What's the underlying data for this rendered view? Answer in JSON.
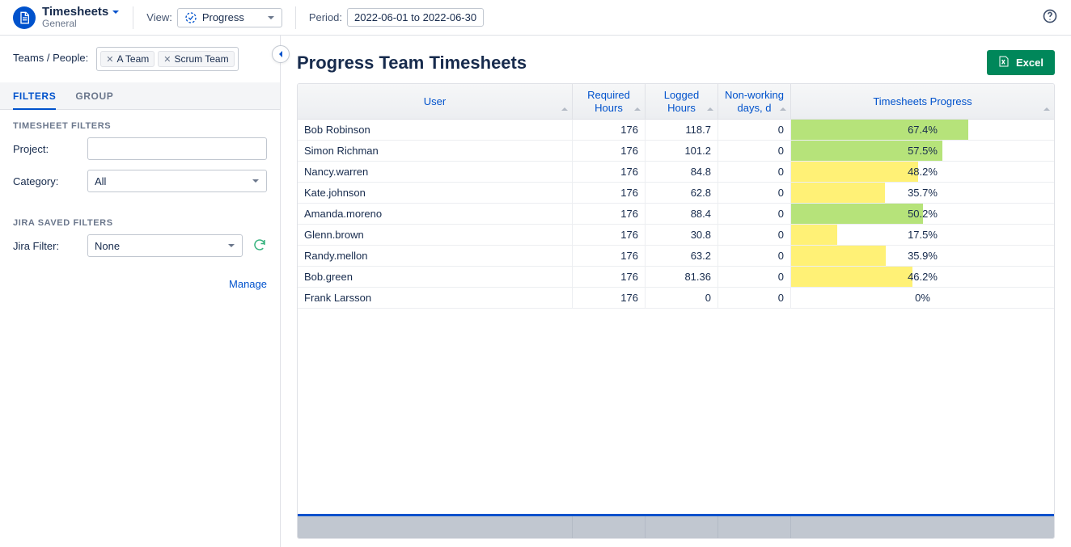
{
  "header": {
    "app_title": "Timesheets",
    "app_subtitle": "General",
    "view_label": "View:",
    "view_value": "Progress",
    "period_label": "Period:",
    "period_value": "2022-06-01 to 2022-06-30"
  },
  "sidebar": {
    "teams_label": "Teams / People:",
    "chips": [
      "A Team",
      "Scrum Team"
    ],
    "tabs": {
      "filters": "FILTERS",
      "group": "GROUP"
    },
    "timesheet_filters_title": "TIMESHEET FILTERS",
    "project_label": "Project:",
    "project_value": "",
    "category_label": "Category:",
    "category_value": "All",
    "jira_filters_title": "JIRA SAVED FILTERS",
    "jira_filter_label": "Jira Filter:",
    "jira_filter_value": "None",
    "manage_label": "Manage"
  },
  "main": {
    "title": "Progress Team Timesheets",
    "excel_label": "Excel",
    "columns": {
      "user": "User",
      "required": "Required Hours",
      "logged": "Logged Hours",
      "nwd": "Non-working days, d",
      "progress": "Timesheets Progress"
    },
    "rows": [
      {
        "user": "Bob Robinson",
        "required": "176",
        "logged": "118.7",
        "nwd": "0",
        "progress_pct": 67.4,
        "progress_label": "67.4%",
        "bar_color": "green"
      },
      {
        "user": "Simon Richman",
        "required": "176",
        "logged": "101.2",
        "nwd": "0",
        "progress_pct": 57.5,
        "progress_label": "57.5%",
        "bar_color": "green"
      },
      {
        "user": "Nancy.warren",
        "required": "176",
        "logged": "84.8",
        "nwd": "0",
        "progress_pct": 48.2,
        "progress_label": "48.2%",
        "bar_color": "yellow"
      },
      {
        "user": "Kate.johnson",
        "required": "176",
        "logged": "62.8",
        "nwd": "0",
        "progress_pct": 35.7,
        "progress_label": "35.7%",
        "bar_color": "yellow"
      },
      {
        "user": "Amanda.moreno",
        "required": "176",
        "logged": "88.4",
        "nwd": "0",
        "progress_pct": 50.2,
        "progress_label": "50.2%",
        "bar_color": "green"
      },
      {
        "user": "Glenn.brown",
        "required": "176",
        "logged": "30.8",
        "nwd": "0",
        "progress_pct": 17.5,
        "progress_label": "17.5%",
        "bar_color": "yellow"
      },
      {
        "user": "Randy.mellon",
        "required": "176",
        "logged": "63.2",
        "nwd": "0",
        "progress_pct": 35.9,
        "progress_label": "35.9%",
        "bar_color": "yellow"
      },
      {
        "user": "Bob.green",
        "required": "176",
        "logged": "81.36",
        "nwd": "0",
        "progress_pct": 46.2,
        "progress_label": "46.2%",
        "bar_color": "yellow"
      },
      {
        "user": "Frank Larsson",
        "required": "176",
        "logged": "0",
        "nwd": "0",
        "progress_pct": 0,
        "progress_label": "0%",
        "bar_color": "none"
      }
    ]
  }
}
